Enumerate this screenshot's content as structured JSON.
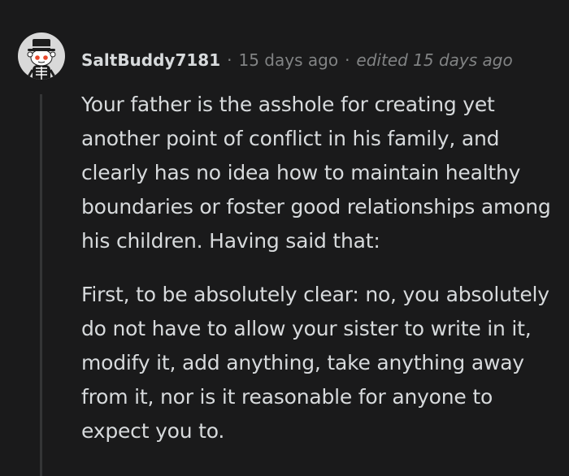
{
  "comment": {
    "username": "SaltBuddy7181",
    "separator": "·",
    "timestamp": "15 days ago",
    "edited": "edited 15 days ago",
    "paragraphs": [
      "Your father is the asshole for creating yet another point of conflict in his family, and clearly has no idea how to maintain healthy boundaries or foster good relationships among his children. Having said that:",
      "First, to be absolutely clear: no, you absolutely do not have to allow your sister to write in it, modify it, add anything, take anything away from it, nor is it reasonable for anyone to expect you to."
    ]
  },
  "avatar": {
    "icon": "snoo-skeleton-avatar",
    "colors": {
      "background": "#d9d9d9",
      "hat": "#1c1c1c",
      "eyes": "#e8472b"
    }
  },
  "colors": {
    "background": "#1a1a1b",
    "text": "#d7dadc",
    "muted": "#818384",
    "thread_line": "#343536"
  }
}
